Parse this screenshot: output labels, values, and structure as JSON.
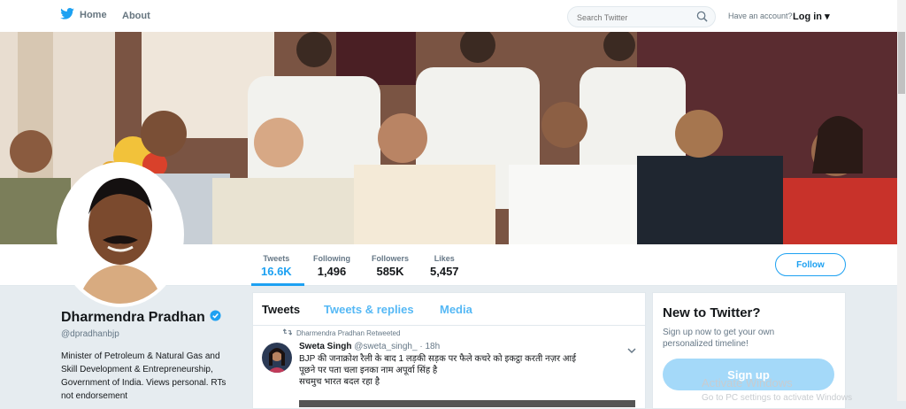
{
  "nav": {
    "home_label": "Home",
    "about_label": "About",
    "search_placeholder": "Search Twitter",
    "have_account": "Have an account?",
    "login_label": "Log in"
  },
  "profile": {
    "name": "Dharmendra Pradhan",
    "handle": "@dpradhanbjp",
    "bio": "Minister of Petroleum & Natural Gas and Skill Development & Entrepreneurship, Government of India. Views personal. RTs not endorsement",
    "verified": true
  },
  "stats": [
    {
      "label": "Tweets",
      "value": "16.6K",
      "active": true
    },
    {
      "label": "Following",
      "value": "1,496",
      "active": false
    },
    {
      "label": "Followers",
      "value": "585K",
      "active": false
    },
    {
      "label": "Likes",
      "value": "5,457",
      "active": false
    }
  ],
  "follow_label": "Follow",
  "timeline": {
    "tabs": [
      "Tweets",
      "Tweets & replies",
      "Media"
    ],
    "active_tab": "Tweets",
    "tweet": {
      "retweet_context": "Dharmendra Pradhan Retweeted",
      "author_name": "Sweta Singh",
      "author_handle": "@sweta_singh_",
      "time": "18h",
      "text_line1": "BJP की जनाक्रोश रैली के बाद 1 लड़की सड़क पर फैले कचरे को इकट्ठा करती नज़र आई",
      "text_line2": "पूछने पर पता चला इनका नाम अपूर्वा सिंह है",
      "text_line3": "सचमुच भारत बदल रहा है"
    }
  },
  "signup": {
    "title": "New to Twitter?",
    "subtitle": "Sign up now to get your own personalized timeline!",
    "button": "Sign up"
  },
  "watermark": {
    "title": "Activate Windows",
    "subtitle": "Go to PC settings to activate Windows"
  },
  "colors": {
    "brand": "#1da1f2",
    "background": "#e6ecf0",
    "text_muted": "#657786"
  }
}
